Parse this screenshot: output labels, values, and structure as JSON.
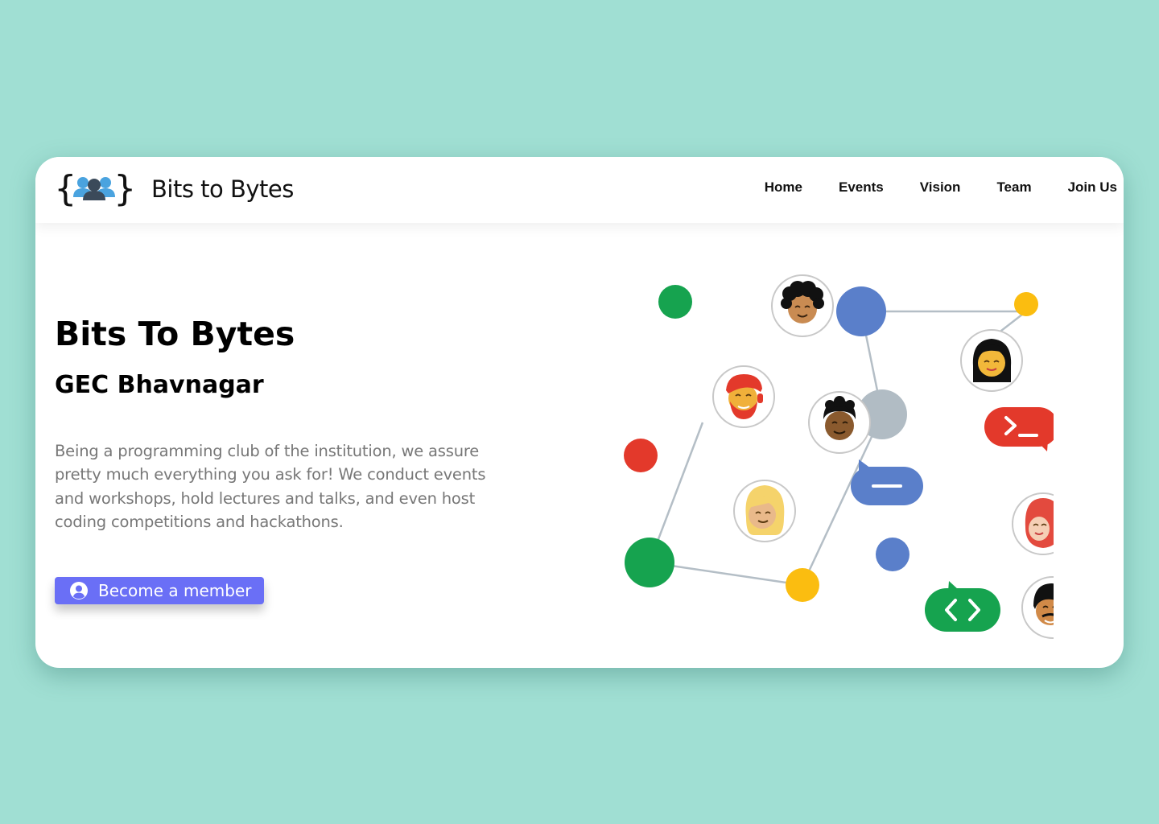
{
  "navbar": {
    "brand_name": "Bits to Bytes",
    "logo_icon": "people-braces-icon",
    "links": [
      {
        "label": "Home"
      },
      {
        "label": "Events"
      },
      {
        "label": "Vision"
      },
      {
        "label": "Team"
      },
      {
        "label": "Join Us"
      }
    ]
  },
  "hero": {
    "title": "Bits To Bytes",
    "subtitle": "GEC Bhavnagar",
    "description": "Being a programming club of the institution, we assure pretty much everything you ask for! We conduct events and workshops, hold lectures and talks, and even host coding competitions and hackathons.",
    "cta_label": "Become a member",
    "cta_icon": "user-circle-icon"
  },
  "colors": {
    "page_background": "#a0dfd3",
    "accent": "#6a6ff6",
    "google_green": "#16a34f",
    "google_blue": "#5a7fca",
    "google_red": "#e3392b",
    "google_yellow": "#fbbd10",
    "gray_node": "#b1bcc4"
  }
}
